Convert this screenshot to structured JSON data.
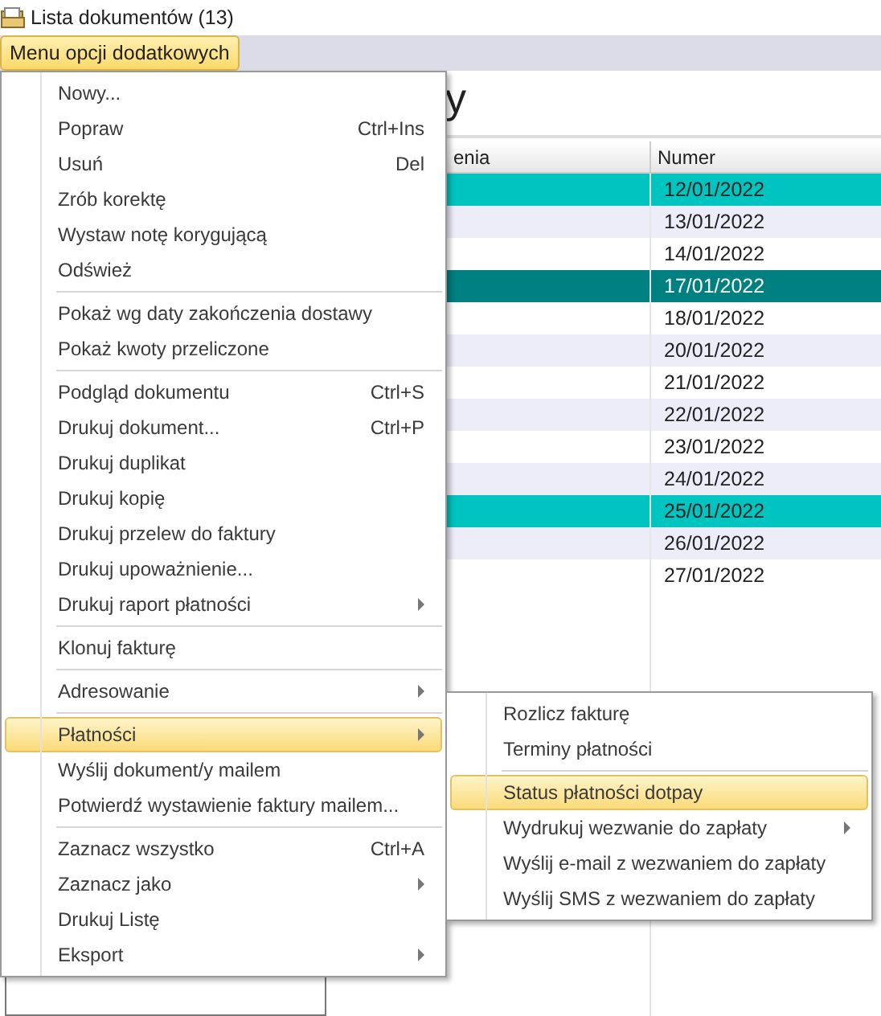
{
  "window": {
    "title": "Lista dokumentów (13)"
  },
  "menu_button": {
    "label": "Menu opcji dodatkowych",
    "selected": true
  },
  "panel": {
    "heading": "y"
  },
  "table": {
    "columns": [
      "enia",
      "Numer"
    ],
    "rows": [
      {
        "cells": [
          "",
          "12/01/2022"
        ],
        "selected": true,
        "current": false
      },
      {
        "cells": [
          "",
          "13/01/2022"
        ],
        "selected": false,
        "current": false
      },
      {
        "cells": [
          "",
          "14/01/2022"
        ],
        "selected": false,
        "current": false
      },
      {
        "cells": [
          "",
          "17/01/2022"
        ],
        "selected": true,
        "current": true
      },
      {
        "cells": [
          "",
          "18/01/2022"
        ],
        "selected": false,
        "current": false
      },
      {
        "cells": [
          "",
          "20/01/2022"
        ],
        "selected": false,
        "current": false
      },
      {
        "cells": [
          "",
          "21/01/2022"
        ],
        "selected": false,
        "current": false
      },
      {
        "cells": [
          "",
          "22/01/2022"
        ],
        "selected": false,
        "current": false
      },
      {
        "cells": [
          "",
          "23/01/2022"
        ],
        "selected": false,
        "current": false
      },
      {
        "cells": [
          "",
          "24/01/2022"
        ],
        "selected": false,
        "current": false
      },
      {
        "cells": [
          "",
          "25/01/2022"
        ],
        "selected": true,
        "current": false
      },
      {
        "cells": [
          "",
          "26/01/2022"
        ],
        "selected": false,
        "current": false
      },
      {
        "cells": [
          "",
          "27/01/2022"
        ],
        "selected": false,
        "current": false
      }
    ]
  },
  "context_menu": {
    "items": [
      {
        "kind": "item",
        "label": "Nowy...",
        "selected": false,
        "submenu": false
      },
      {
        "kind": "item",
        "label": "Popraw",
        "shortcut": "Ctrl+Ins",
        "selected": false,
        "submenu": false
      },
      {
        "kind": "item",
        "label": "Usuń",
        "shortcut": "Del",
        "selected": false,
        "submenu": false
      },
      {
        "kind": "item",
        "label": "Zrób korektę",
        "selected": false,
        "submenu": false
      },
      {
        "kind": "item",
        "label": "Wystaw notę korygującą",
        "selected": false,
        "submenu": false
      },
      {
        "kind": "item",
        "label": "Odśwież",
        "selected": false,
        "submenu": false
      },
      {
        "kind": "separator"
      },
      {
        "kind": "item",
        "label": "Pokaż wg daty zakończenia dostawy",
        "selected": false,
        "submenu": false
      },
      {
        "kind": "item",
        "label": "Pokaż kwoty przeliczone",
        "selected": false,
        "submenu": false
      },
      {
        "kind": "separator"
      },
      {
        "kind": "item",
        "label": "Podgląd dokumentu",
        "shortcut": "Ctrl+S",
        "selected": false,
        "submenu": false
      },
      {
        "kind": "item",
        "label": "Drukuj dokument...",
        "shortcut": "Ctrl+P",
        "selected": false,
        "submenu": false
      },
      {
        "kind": "item",
        "label": "Drukuj duplikat",
        "selected": false,
        "submenu": false
      },
      {
        "kind": "item",
        "label": "Drukuj kopię",
        "selected": false,
        "submenu": false
      },
      {
        "kind": "item",
        "label": "Drukuj przelew do faktury",
        "selected": false,
        "submenu": false
      },
      {
        "kind": "item",
        "label": "Drukuj upoważnienie...",
        "selected": false,
        "submenu": false
      },
      {
        "kind": "item",
        "label": "Drukuj raport płatności",
        "selected": false,
        "submenu": true
      },
      {
        "kind": "separator"
      },
      {
        "kind": "item",
        "label": "Klonuj fakturę",
        "selected": false,
        "submenu": false
      },
      {
        "kind": "separator"
      },
      {
        "kind": "item",
        "label": "Adresowanie",
        "selected": false,
        "submenu": true
      },
      {
        "kind": "separator"
      },
      {
        "kind": "item",
        "label": "Płatności",
        "selected": true,
        "submenu": true
      },
      {
        "kind": "item",
        "label": "Wyślij dokument/y mailem",
        "selected": false,
        "submenu": false
      },
      {
        "kind": "item",
        "label": "Potwierdź wystawienie faktury mailem...",
        "selected": false,
        "submenu": false
      },
      {
        "kind": "separator"
      },
      {
        "kind": "item",
        "label": "Zaznacz wszystko",
        "shortcut": "Ctrl+A",
        "selected": false,
        "submenu": false
      },
      {
        "kind": "item",
        "label": "Zaznacz jako",
        "selected": false,
        "submenu": true
      },
      {
        "kind": "item",
        "label": "Drukuj Listę",
        "selected": false,
        "submenu": false
      },
      {
        "kind": "item",
        "label": "Eksport",
        "selected": false,
        "submenu": true
      }
    ]
  },
  "submenu": {
    "items": [
      {
        "kind": "item",
        "label": "Rozlicz fakturę",
        "selected": false,
        "submenu": false
      },
      {
        "kind": "item",
        "label": "Terminy płatności",
        "selected": false,
        "submenu": false
      },
      {
        "kind": "separator"
      },
      {
        "kind": "item",
        "label": "Status płatności dotpay",
        "selected": true,
        "submenu": false
      },
      {
        "kind": "item",
        "label": "Wydrukuj wezwanie do zapłaty",
        "selected": false,
        "submenu": true
      },
      {
        "kind": "item",
        "label": "Wyślij e-mail z wezwaniem do zapłaty",
        "selected": false,
        "submenu": false
      },
      {
        "kind": "item",
        "label": "Wyślij SMS z wezwaniem do zapłaty",
        "selected": false,
        "submenu": false
      }
    ]
  }
}
